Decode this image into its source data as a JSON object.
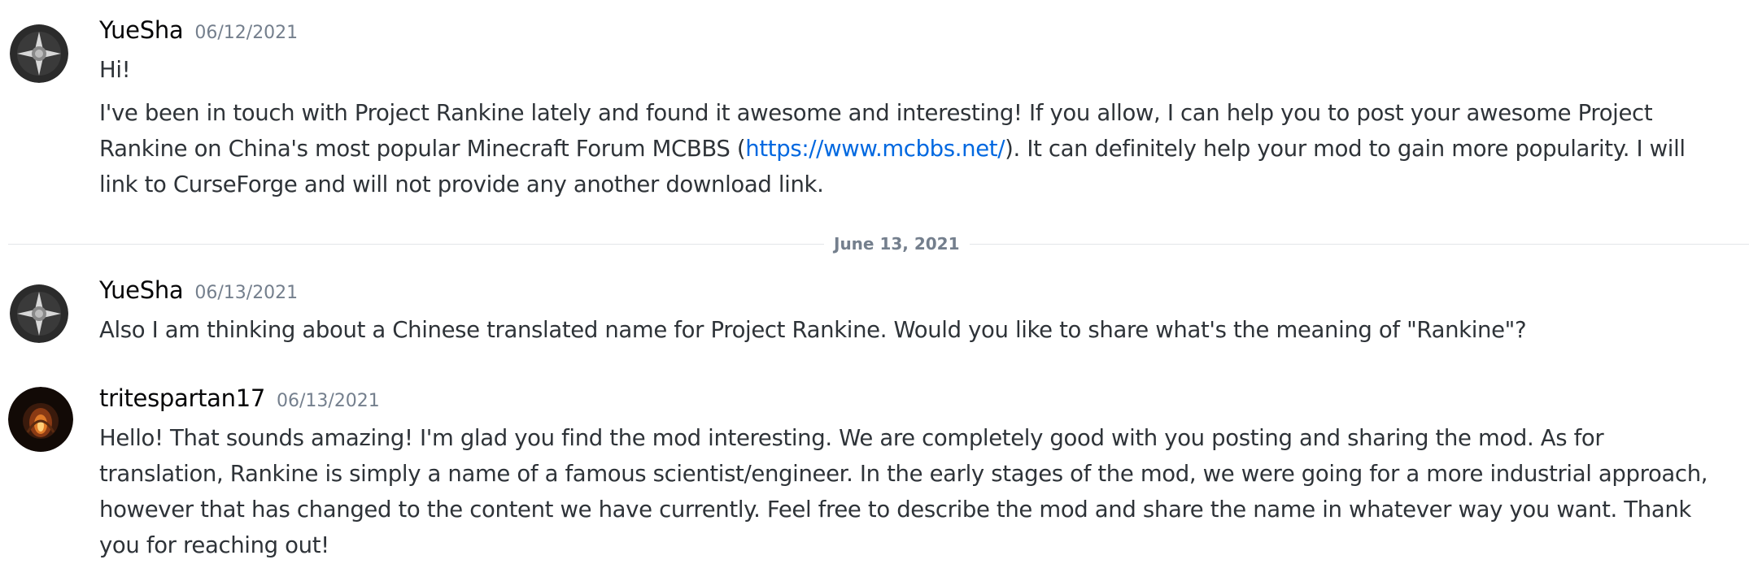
{
  "messages": [
    {
      "author": "YueSha",
      "timestamp": "06/12/2021",
      "avatar": "shield-avatar",
      "lines": {
        "greeting": "Hi!",
        "para_before_link": "I've been in touch with Project Rankine lately and found it awesome and interesting! If you allow, I can help you to post your awesome Project Rankine on China's most popular Minecraft Forum MCBBS (",
        "link": "https://www.mcbbs.net/",
        "para_after_link": "). It can definitely help your mod to gain more popularity. I will link to CurseForge and will not provide any another download link."
      }
    },
    {
      "author": "YueSha",
      "timestamp": "06/13/2021",
      "avatar": "shield-avatar",
      "text": "Also I am thinking about a Chinese translated name for Project Rankine. Would you like to share what's the meaning of \"Rankine\"?"
    },
    {
      "author": "tritespartan17",
      "timestamp": "06/13/2021",
      "avatar": "fire-avatar",
      "text": "Hello! That sounds amazing! I'm glad you find the mod interesting. We are completely good with you posting and sharing the mod. As for translation, Rankine is simply a name of a famous scientist/engineer. In the early stages of the mod, we were going for a more industrial approach, however that has changed to the content we have currently. Feel free to describe the mod and share the name in whatever way you want. Thank you for reaching out!"
    }
  ],
  "date_divider": "June 13, 2021",
  "colors": {
    "link": "#0068e0",
    "timestamp": "#747f8d",
    "text": "#2e3338",
    "divider": "#e3e5e8"
  }
}
